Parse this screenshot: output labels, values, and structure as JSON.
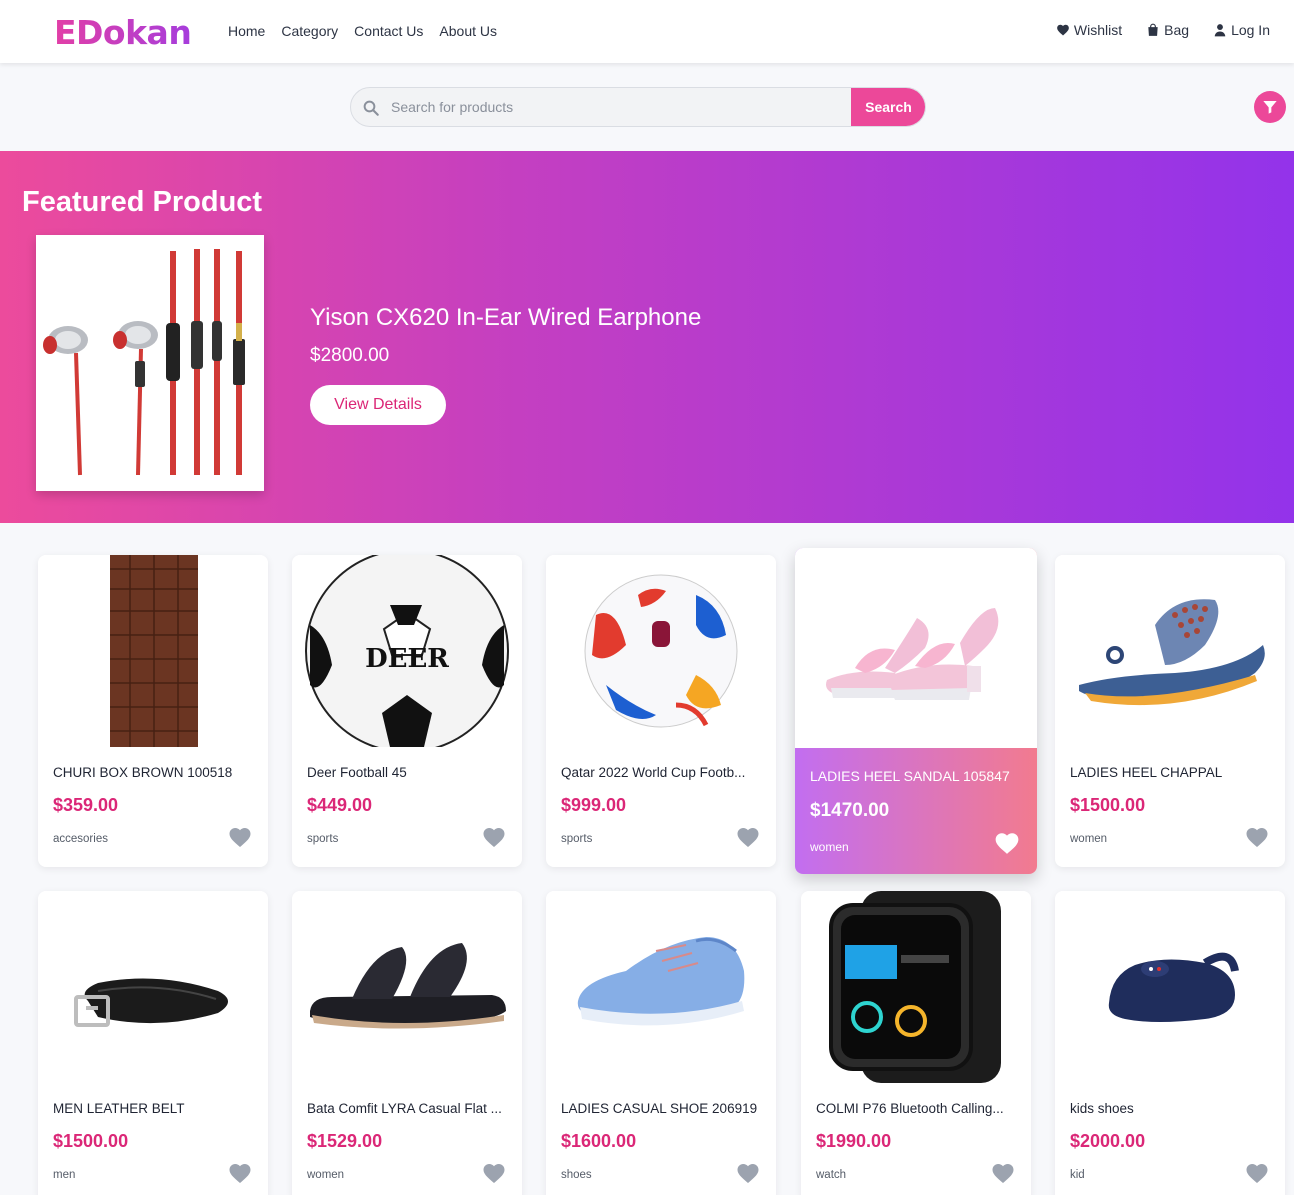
{
  "brand": {
    "logo": "EDokan"
  },
  "nav": {
    "items": [
      "Home",
      "Category",
      "Contact Us",
      "About Us"
    ]
  },
  "header_actions": {
    "wishlist": "Wishlist",
    "bag": "Bag",
    "login": "Log In"
  },
  "search": {
    "placeholder": "Search for products",
    "button": "Search"
  },
  "hero": {
    "title": "Featured Product",
    "product_name": "Yison CX620 In-Ear Wired Earphone",
    "price": "$2800.00",
    "button": "View Details"
  },
  "products": [
    {
      "name": "CHURI BOX BROWN 100518",
      "price": "$359.00",
      "category": "accesories",
      "icon": "leather-strap"
    },
    {
      "name": "Deer Football 45",
      "price": "$449.00",
      "category": "sports",
      "icon": "soccer-ball"
    },
    {
      "name": "Qatar 2022 World Cup Footb...",
      "price": "$999.00",
      "category": "sports",
      "icon": "soccer-ball-colorful"
    },
    {
      "name": "LADIES HEEL SANDAL 105847",
      "price": "$1470.00",
      "category": "women",
      "icon": "pink-sandal",
      "active": true
    },
    {
      "name": "LADIES HEEL CHAPPAL",
      "price": "$1500.00",
      "category": "women",
      "icon": "blue-sandal"
    },
    {
      "name": "MEN LEATHER BELT",
      "price": "$1500.00",
      "category": "men",
      "icon": "belt"
    },
    {
      "name": "Bata Comfit LYRA Casual Flat ...",
      "price": "$1529.00",
      "category": "women",
      "icon": "black-sandal"
    },
    {
      "name": "LADIES CASUAL SHOE 206919",
      "price": "$1600.00",
      "category": "shoes",
      "icon": "blue-sneaker"
    },
    {
      "name": "COLMI P76 Bluetooth Calling...",
      "price": "$1990.00",
      "category": "watch",
      "icon": "smartwatch"
    },
    {
      "name": "kids shoes",
      "price": "$2000.00",
      "category": "kid",
      "icon": "kids-shoe"
    }
  ],
  "colors": {
    "accent": "#ec4899",
    "price": "#db2777",
    "hero_start": "#ec4b9c",
    "hero_end": "#9333ea"
  }
}
